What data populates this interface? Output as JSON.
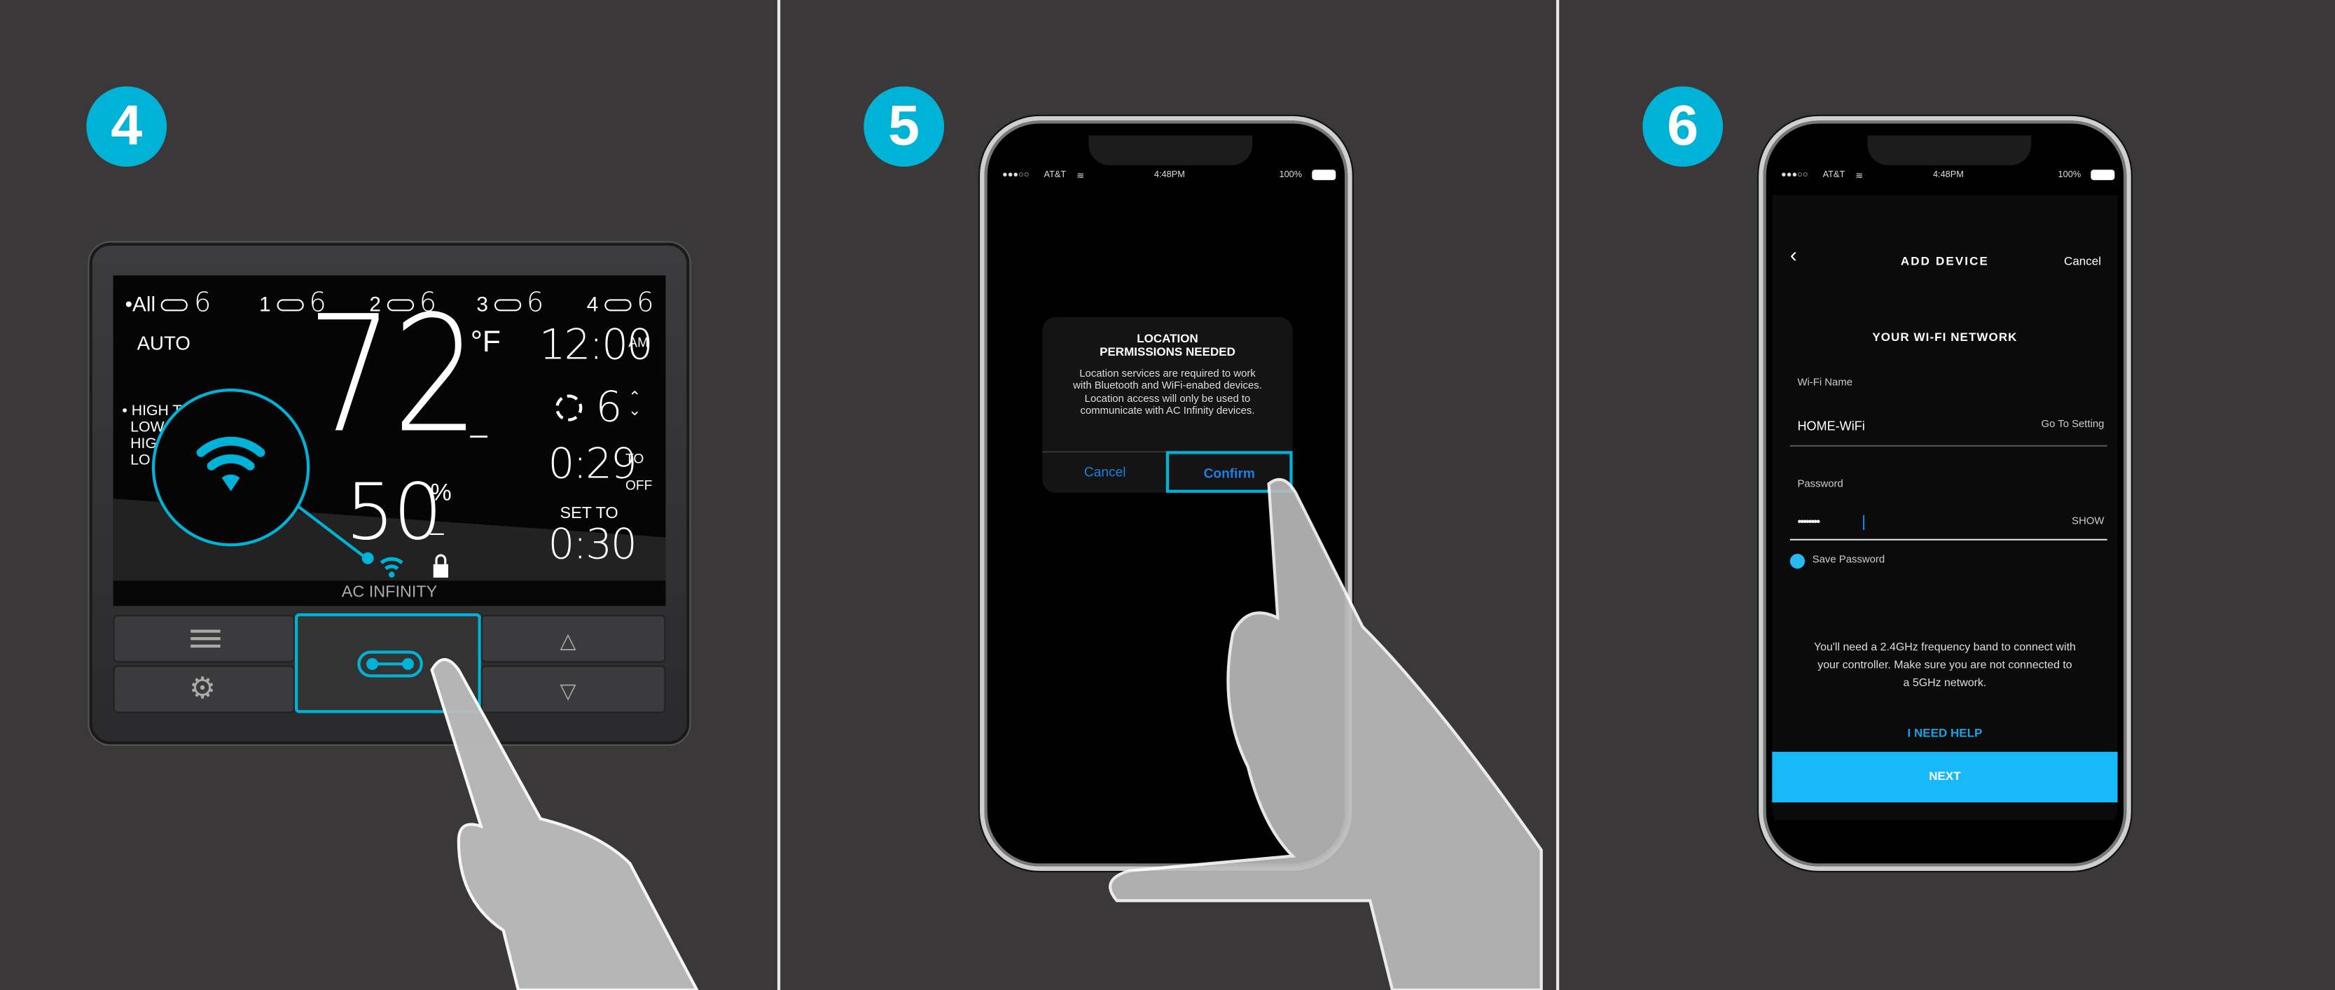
{
  "colors": {
    "accent": "#00b2d6",
    "background": "#3a3839",
    "next_button": "#17b9f9",
    "link_blue": "#1f7fe0"
  },
  "steps": [
    {
      "number": "4"
    },
    {
      "number": "5"
    },
    {
      "number": "6"
    }
  ],
  "controller": {
    "ports": [
      {
        "label": "All",
        "level": "6",
        "selected": true
      },
      {
        "label": "1",
        "level": "6"
      },
      {
        "label": "2",
        "level": "6"
      },
      {
        "label": "3",
        "level": "6"
      },
      {
        "label": "4",
        "level": "6"
      }
    ],
    "mode": "AUTO",
    "triggers": [
      "HIGH T",
      "LOW",
      "HIG",
      "LO"
    ],
    "temperature": "72",
    "temp_unit": "°F",
    "temp_dash": "_",
    "clock": "12:00",
    "ampm": "AM",
    "speed": "6",
    "timer": "0:29",
    "timer_to": "TO",
    "timer_off": "OFF",
    "set_to_label": "SET TO",
    "set_to_value": "0:30",
    "humidity": "50",
    "humidity_unit": "%",
    "humidity_dash": "_",
    "brand": "AC INFINITY",
    "icons": {
      "menu": "menu-icon",
      "settings": "gear-icon",
      "port": "port-link-icon",
      "up": "chevron-up-icon",
      "down": "chevron-down-icon",
      "wifi": "wifi-icon",
      "lock": "lock-icon"
    }
  },
  "status_bar": {
    "carrier": "AT&T",
    "time": "4:48PM",
    "battery": "100%",
    "signal": "●●●○○"
  },
  "permission_dialog": {
    "title_line1": "LOCATION",
    "title_line2": "PERMISSIONS NEEDED",
    "body": "Location services are required to work with Bluetooth and WiFi-enabed devices. Location access will only be used to communicate with AC Infinity devices.",
    "cancel": "Cancel",
    "confirm": "Confirm"
  },
  "add_device": {
    "title": "ADD DEVICE",
    "cancel": "Cancel",
    "section": "YOUR WI-FI NETWORK",
    "wifi_name_label": "Wi-Fi Name",
    "wifi_name_value": "HOME-WiFi",
    "go_to_setting": "Go To Setting",
    "password_label": "Password",
    "password_value": "••••••••",
    "show": "SHOW",
    "save_password": "Save Password",
    "save_password_checked": true,
    "note": "You'll need a 2.4GHz frequency band to connect with your controller. Make sure you are not connected to a 5GHz network.",
    "help": "I NEED HELP",
    "next": "NEXT"
  }
}
